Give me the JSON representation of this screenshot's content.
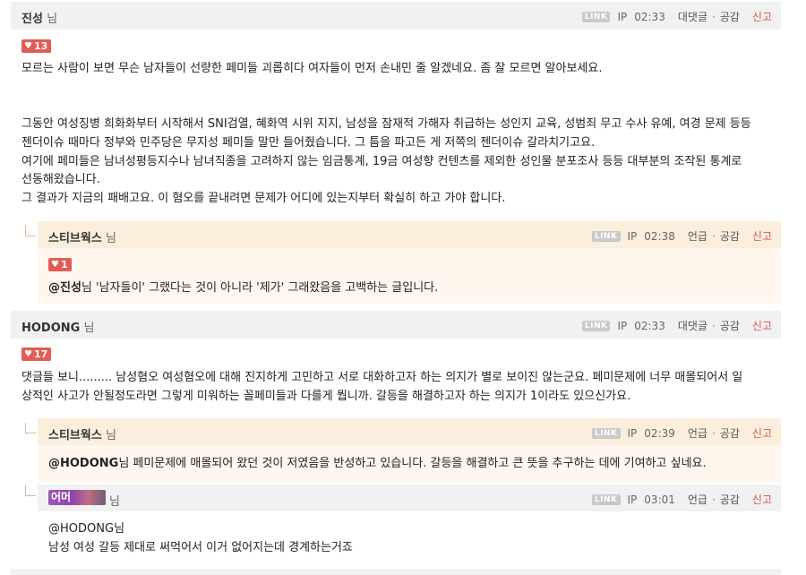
{
  "comments": [
    {
      "author": "진성",
      "suffix": "님",
      "link_label": "LINK",
      "ip_label": "IP",
      "time": "02:33",
      "action1": "대댓글",
      "action2": "공감",
      "report": "신고",
      "likes": "13",
      "body": [
        "모르는 사람이 보면 무슨 남자들이 선량한 페미들 괴롭히다 여자들이 먼저 손내민 줄 알겠네요. 좀 잘 모르면 알아보세요.",
        "",
        "",
        "그동안 여성징병 희화화부터 시작해서 SNI검열, 혜화역 시위 지지, 남성을 잠재적 가해자 취급하는 성인지 교육, 성범죄 무고 수사 유예, 여경 문제 등등",
        "젠더이슈 때마다 정부와 민주당은 무지성 페미들 말만 들어줬습니다. 그 틈을 파고든 게 저쪽의 젠더이슈 갈라치기고요.",
        "여기에 페미들은 남녀성평등지수나 남녀직종을 고려하지 않는 임금통계, 19금 여성향 컨텐츠를 제외한 성인물 분포조사 등등 대부분의 조작된 통계로",
        "선동해왔습니다.",
        "그 결과가 지금의 패배고요. 이 혐오를 끝내려면 문제가 어디에 있는지부터 확실히 하고 가야 합니다."
      ]
    },
    {
      "author": "HODONG",
      "suffix": "님",
      "link_label": "LINK",
      "ip_label": "IP",
      "time": "02:33",
      "action1": "대댓글",
      "action2": "공감",
      "report": "신고",
      "likes": "17",
      "body": [
        "댓글들 보니......... 남성혐오 여성혐오에 대해 진지하게 고민하고 서로 대화하고자 하는 의지가 별로 보이진 않는군요. 페미문제에 너무 매몰되어서 일",
        "상적인 사고가 안될정도라면 그렇게 미워하는 꼴페미들과 다를게 뭡니까. 갈등을 해결하고자 하는 의지가 1이라도 있으신가요."
      ]
    }
  ],
  "replies": [
    {
      "author": "스티브웍스",
      "suffix": "님",
      "link_label": "LINK",
      "ip_label": "IP",
      "time": "02:38",
      "action1": "언급",
      "action2": "공감",
      "report": "신고",
      "likes": "1",
      "mention": "@진성",
      "body": "님 '남자들이' 그랬다는 것이 아니라 '제가' 그래왔음을 고백하는 글입니다."
    },
    {
      "author": "스티브웍스",
      "suffix": "님",
      "link_label": "LINK",
      "ip_label": "IP",
      "time": "02:39",
      "action1": "언급",
      "action2": "공감",
      "report": "신고",
      "mention": "@HODONG",
      "body": "님 페미문제에 매몰되어 왔던 것이 저였음을 반성하고 있습니다. 갈등을 해결하고 큰 뜻을 추구하는 데에 기여하고 싶네요."
    },
    {
      "author": "어머",
      "suffix": "님",
      "link_label": "LINK",
      "ip_label": "IP",
      "time": "03:01",
      "action1": "언급",
      "action2": "공감",
      "report": "신고",
      "mention": "@HODONG",
      "mention_suffix": "님",
      "body": "남성 여성 갈등 제대로 써먹어서 이거 없어지는데 경계하는거죠"
    }
  ],
  "colors": {
    "header_bg": "#f1f1f1",
    "reply_header_bg": "#fbeedd",
    "reply_body_bg": "#fff7ee",
    "like_badge": "#e25c55",
    "report": "#d9534f"
  }
}
